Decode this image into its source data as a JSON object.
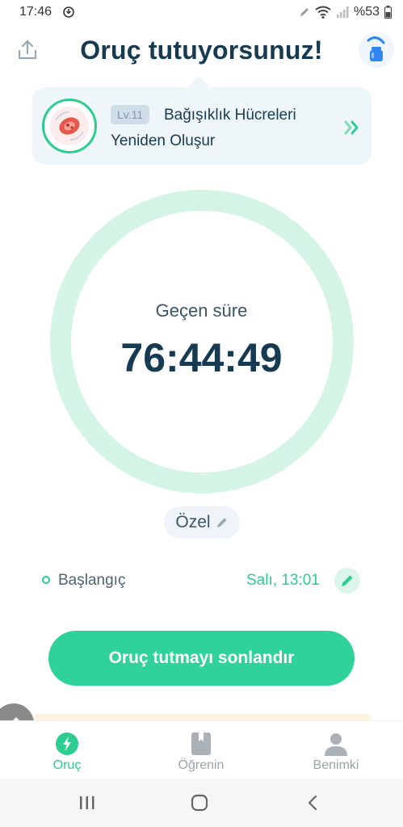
{
  "status_bar": {
    "time": "17:46",
    "battery_text": "%53"
  },
  "header": {
    "title": "Oruç tutuyorsunuz!"
  },
  "stage": {
    "level": "Lv.11",
    "line1": "Bağışıklık Hücreleri",
    "line2": "Yeniden Oluşur"
  },
  "timer": {
    "label": "Geçen süre",
    "value": "76:44:49",
    "ring_color": "#d4f5e6"
  },
  "preset": {
    "label": "Özel"
  },
  "start": {
    "label": "Başlangıç",
    "value": "Salı, 13:01"
  },
  "end_button": {
    "label": "Oruç tutmayı sonlandır"
  },
  "bottom_nav": {
    "items": [
      {
        "label": "Oruç",
        "icon": "lightning-icon",
        "active": true
      },
      {
        "label": "Öğrenin",
        "icon": "book-icon",
        "active": false
      },
      {
        "label": "Benimki",
        "icon": "person-icon",
        "active": false
      }
    ]
  },
  "colors": {
    "accent": "#2ccd8f",
    "title": "#163a52"
  }
}
